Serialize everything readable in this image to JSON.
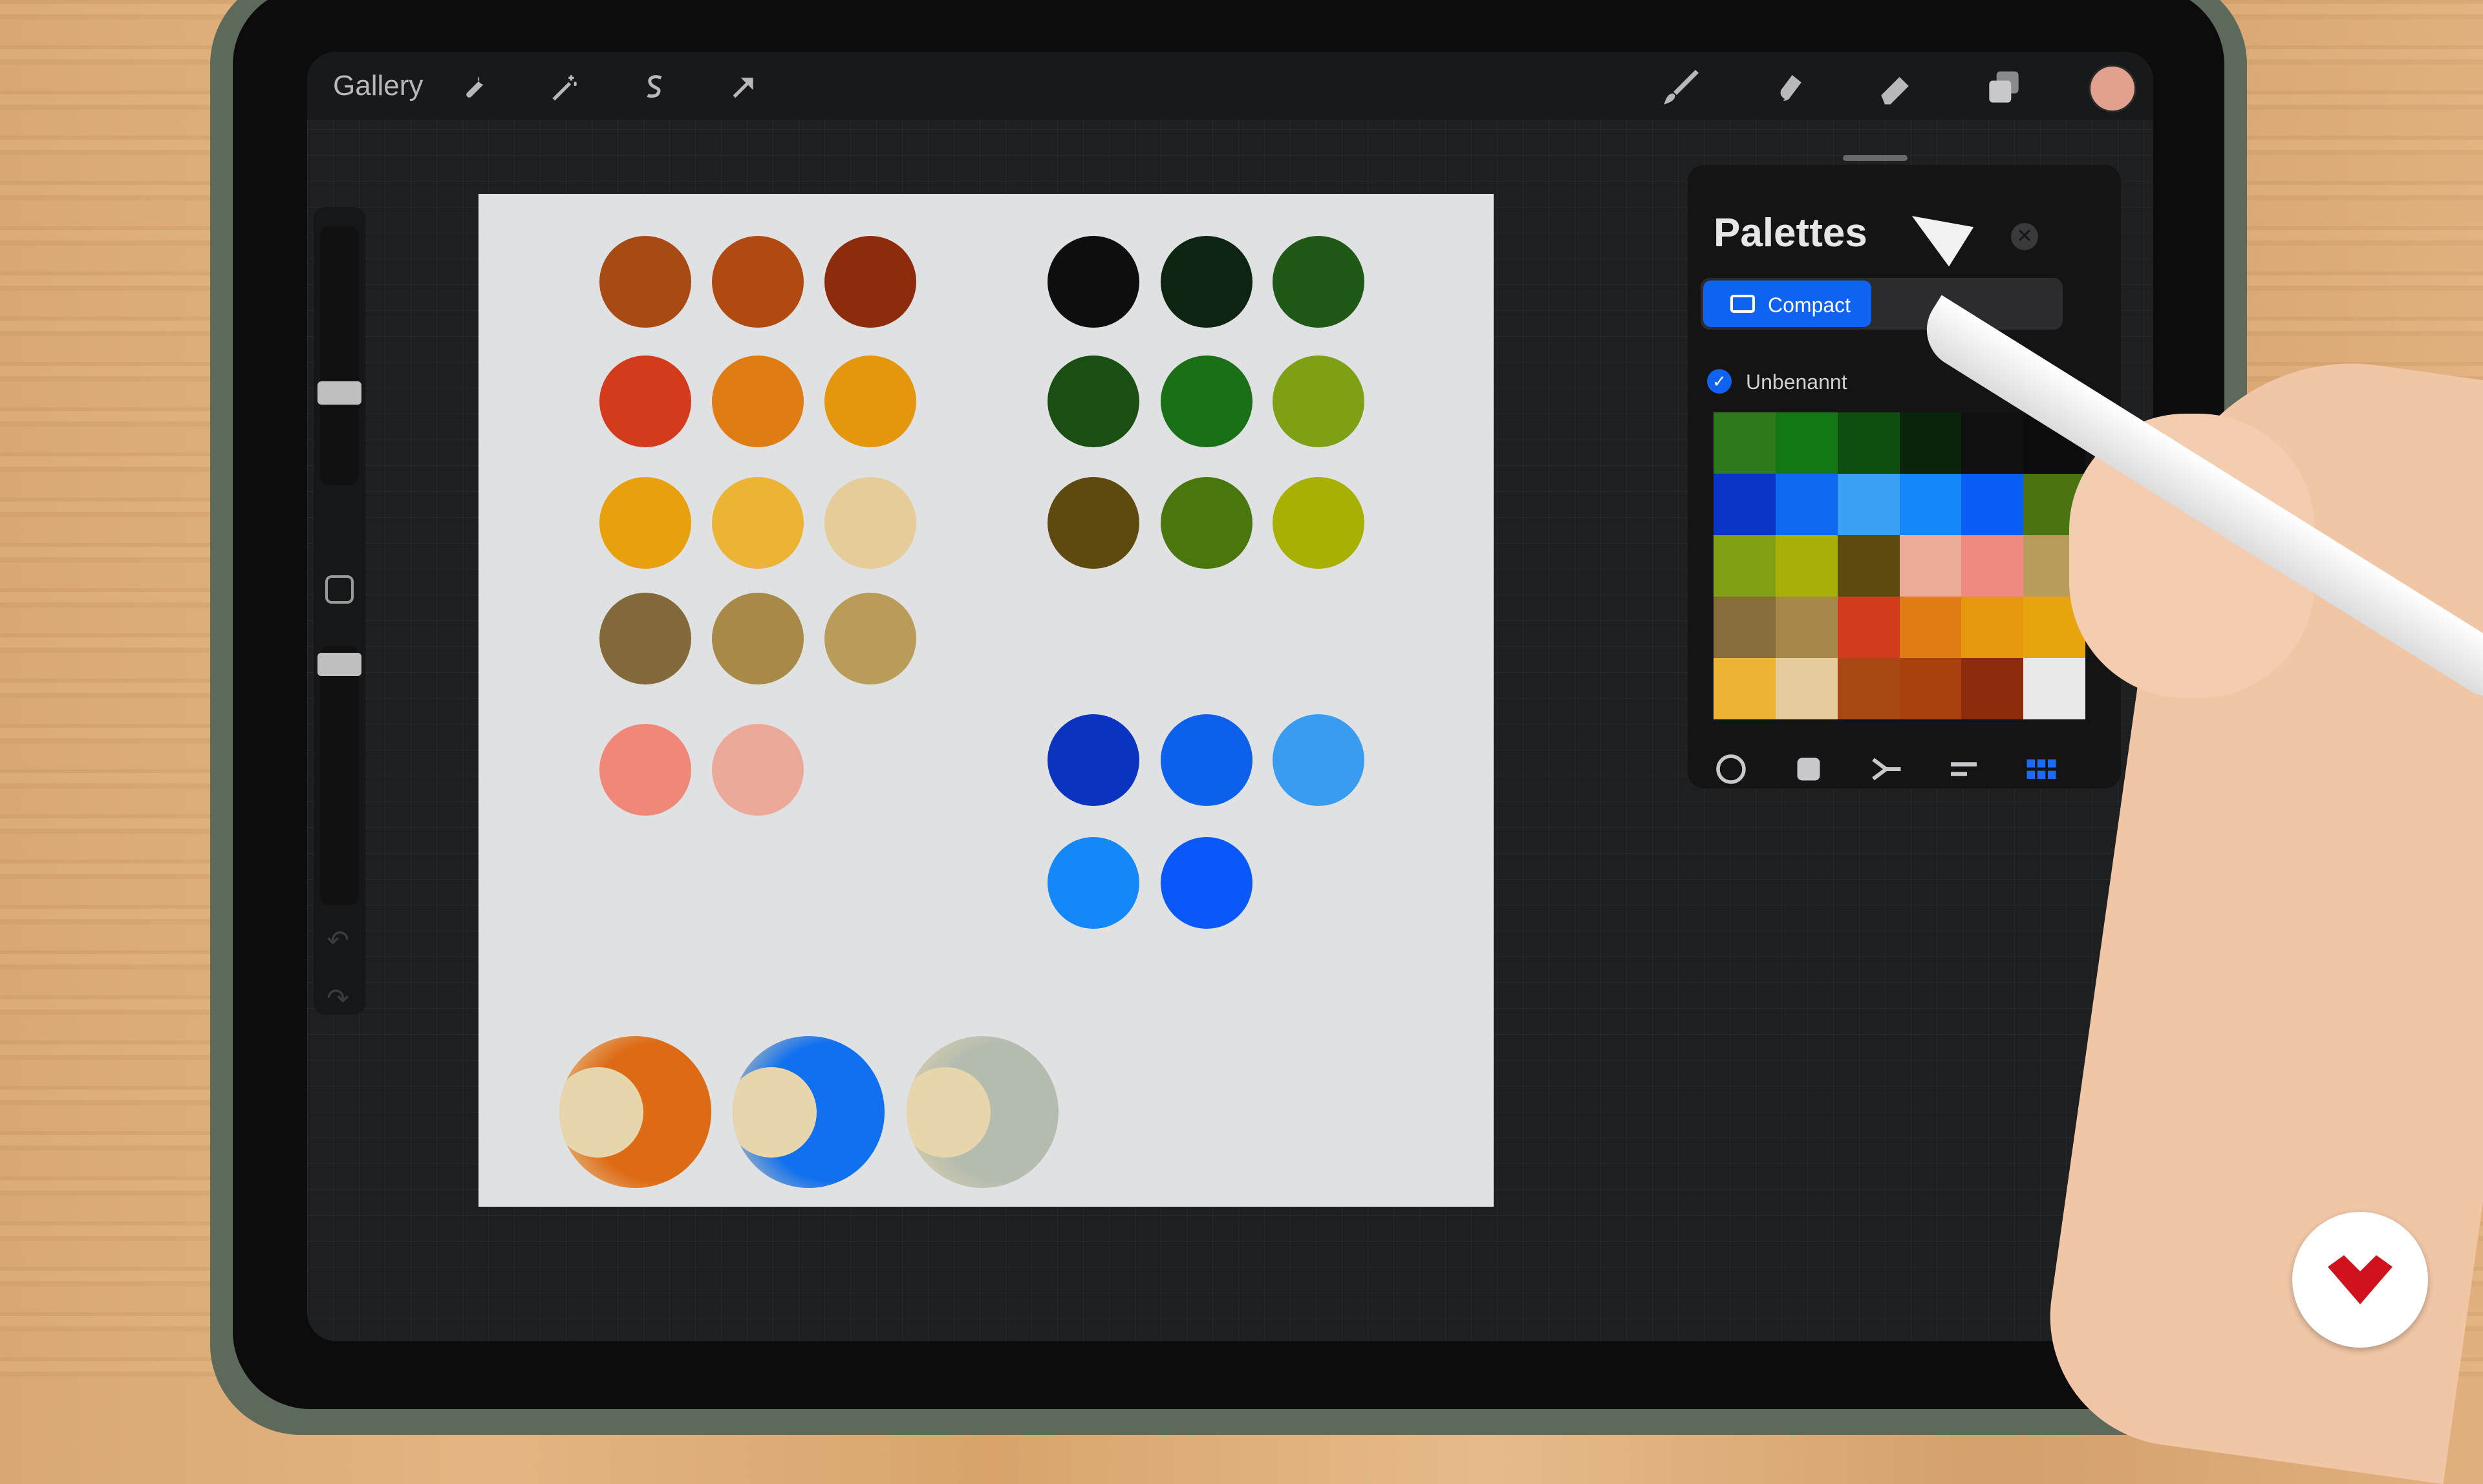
{
  "topbar": {
    "gallery_label": "Gallery",
    "left_tools": [
      "wrench-icon",
      "magic-wand-icon",
      "selection-icon",
      "transform-arrow-icon"
    ],
    "right_tools": [
      "brush-icon",
      "smudge-icon",
      "eraser-icon",
      "layers-icon"
    ],
    "current_color": "#e2a08e"
  },
  "canvas": {
    "warm_dots": [
      "#a84a14",
      "#b04a10",
      "#8c2c0c",
      "#d43a1c",
      "#e07c14",
      "#e4960c",
      "#e8a00c",
      "#ecb434",
      "#e6cc98",
      "#836a3a",
      "#a88a48",
      "#b89c58",
      "#ef8878",
      "#eca898"
    ],
    "green_dots": [
      "#0e0e0e",
      "#0c2410",
      "#1e5a16",
      "#1a4e12",
      "#1a7016",
      "#7ea014",
      "#5e4a0e",
      "#4a760e",
      "#a8b004"
    ],
    "blue_dots": [
      "#0a34c0",
      "#0c60ec",
      "#3a9cf0",
      "#1488f8",
      "#0a58f8"
    ],
    "blends": [
      {
        "outer": "#dd6a14",
        "inner": "#e7d5ab"
      },
      {
        "outer": "#1070f0",
        "inner": "#e7d5ab"
      },
      {
        "outer": "#b4bcb0",
        "inner": "#e7d5ab"
      }
    ]
  },
  "palettes_panel": {
    "title": "Palettes",
    "close_icon": "close-icon",
    "view_compact_label": "Compact",
    "view_card_label": "",
    "palette_name": "Unbenannt",
    "default_checked": true,
    "swatches": [
      "#2e7a1a",
      "#137814",
      "#0e4e10",
      "#0a240c",
      "#101010",
      "#0c0c0c",
      "#0a34c6",
      "#0e68f0",
      "#3aa0f4",
      "#1488f8",
      "#0c5cf8",
      "#4a7412",
      "#82a014",
      "#a8b008",
      "#5e4a0e",
      "#ecaa98",
      "#ee8a80",
      "#b89c5c",
      "#866e3c",
      "#a8884a",
      "#d23c1c",
      "#e07c14",
      "#e4980c",
      "#e8a40c",
      "#ecb434",
      "#e6cc9c",
      "#a84814",
      "#a84010",
      "#8c2c0c",
      "#e8e8e8"
    ],
    "color_modes": [
      "disc-icon",
      "classic-icon",
      "harmony-icon",
      "value-icon",
      "palettes-grid-icon"
    ],
    "active_mode": "palettes-grid-icon"
  }
}
